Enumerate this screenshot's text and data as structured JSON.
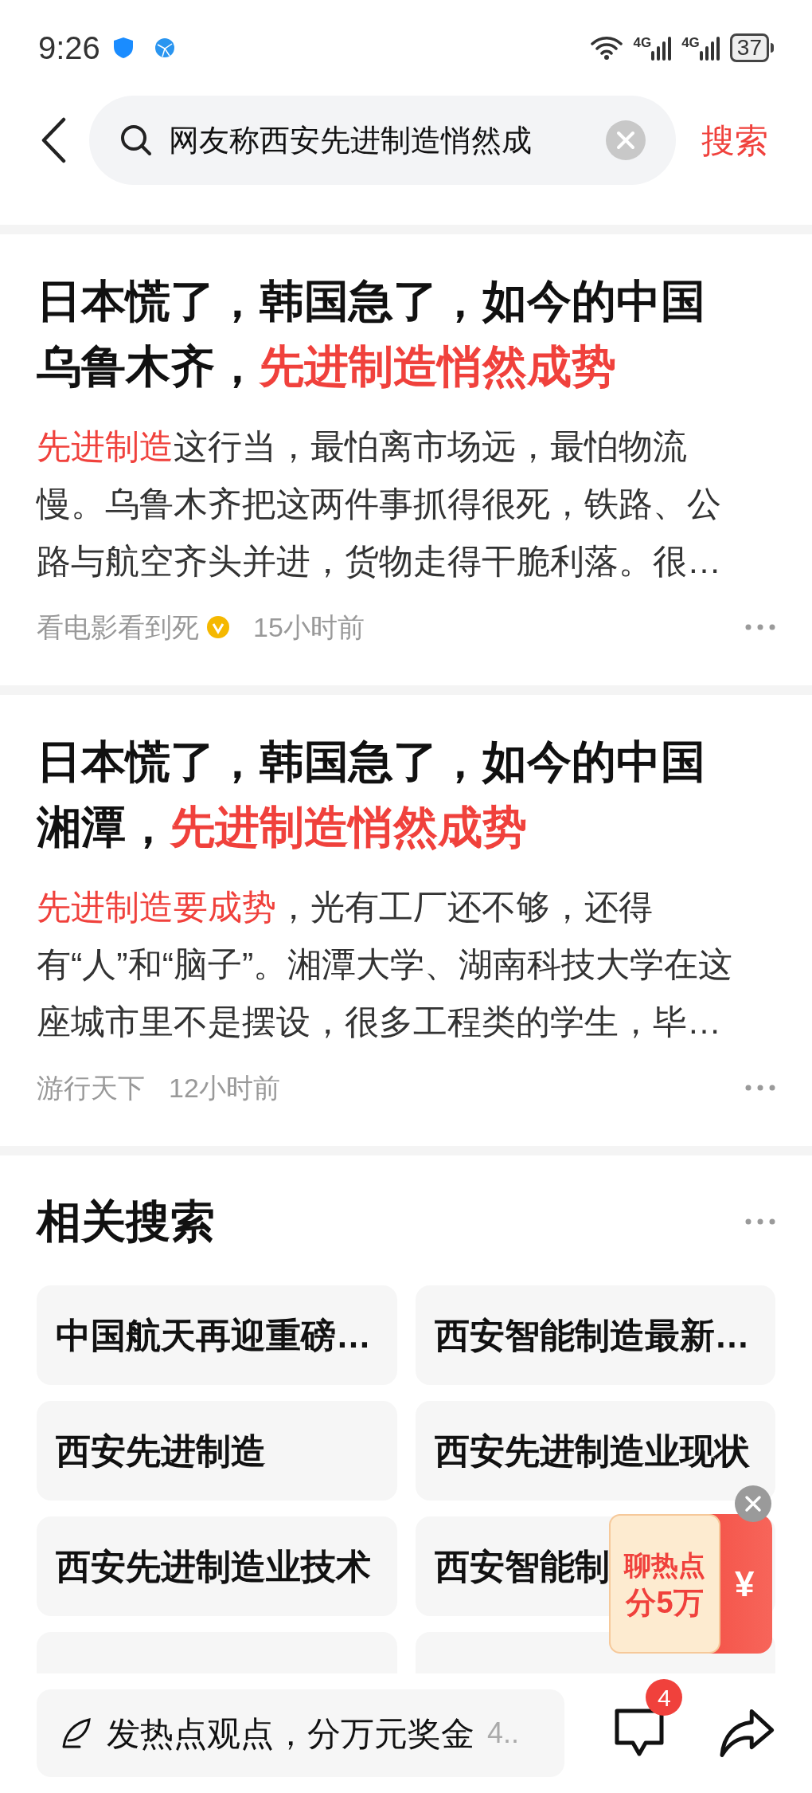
{
  "status_bar": {
    "time": "9:26",
    "network_labels": [
      "4G",
      "4G"
    ],
    "battery": "37"
  },
  "search": {
    "value": "网友称西安先进制造悄然成",
    "button": "搜索"
  },
  "articles": [
    {
      "title": [
        {
          "text": "日本慌了，韩国急了，如今的中国乌鲁木齐，",
          "highlight": false
        },
        {
          "text": "先进制造悄然成势",
          "highlight": true
        }
      ],
      "body": [
        {
          "text": "先进制造",
          "highlight": true
        },
        {
          "text": "这行当，最怕离市场远，最怕物流慢。乌鲁木齐把这两件事抓得很死，铁路、公路与航空齐头并进，货物走得干脆利落。很…",
          "highlight": false
        }
      ],
      "author": "看电影看到死",
      "verified": true,
      "time": "15小时前"
    },
    {
      "title": [
        {
          "text": "日本慌了，韩国急了，如今的中国湘潭，",
          "highlight": false
        },
        {
          "text": "先进制造悄然成势",
          "highlight": true
        }
      ],
      "body": [
        {
          "text": "先进制造要成势",
          "highlight": true
        },
        {
          "text": "，光有工厂还不够，还得有“人”和“脑子”。湘潭大学、湖南科技大学在这座城市里不是摆设，很多工程类的学生，毕…",
          "highlight": false
        }
      ],
      "author": "游行天下",
      "verified": false,
      "time": "12小时前"
    }
  ],
  "related": {
    "title": "相关搜索",
    "items": [
      "中国航天再迎重磅…",
      "西安智能制造最新…",
      "西安先进制造",
      "西安先进制造业现状",
      "西安先进制造业技术",
      "西安智能制"
    ]
  },
  "promo": {
    "line_1": "聊热点",
    "line_2": "分5万",
    "symbol": "¥"
  },
  "bottom_bar": {
    "placeholder": "发热点观点，分万元奖金",
    "hint": "4..",
    "comment_count": "4"
  }
}
